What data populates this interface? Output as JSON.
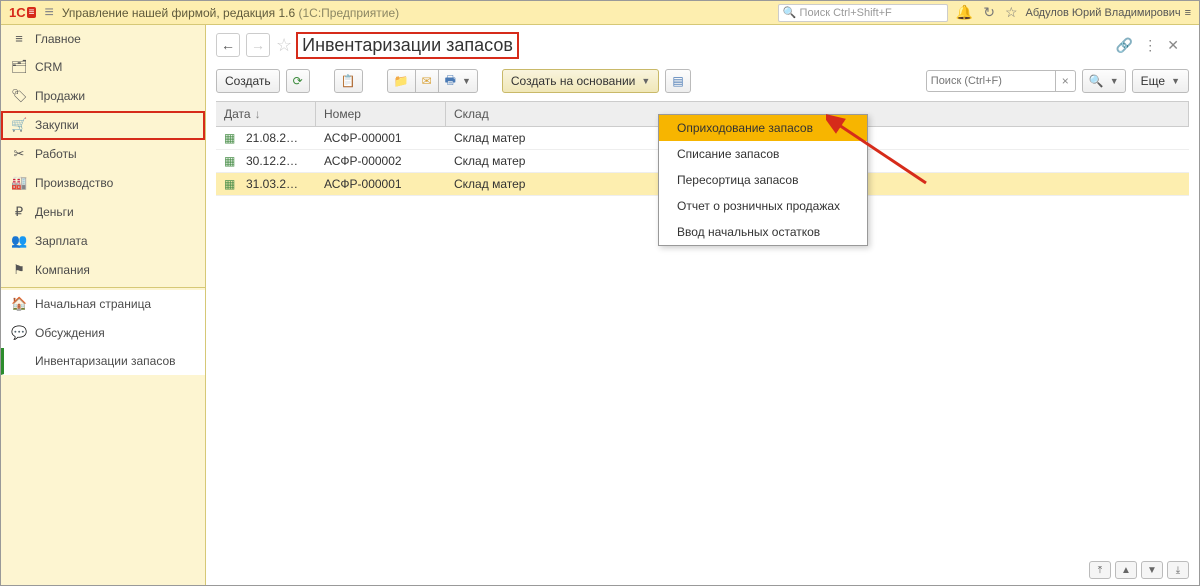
{
  "topbar": {
    "logo": "1C",
    "title": "Управление нашей фирмой, редакция 1.6",
    "sub": "(1С:Предприятие)",
    "search_placeholder": "Поиск Ctrl+Shift+F",
    "user": "Абдулов Юрий Владимирович"
  },
  "sidebar": {
    "items": [
      {
        "icon": "menu",
        "label": "Главное"
      },
      {
        "icon": "crm",
        "label": "CRM"
      },
      {
        "icon": "sales",
        "label": "Продажи"
      },
      {
        "icon": "cart",
        "label": "Закупки"
      },
      {
        "icon": "tools",
        "label": "Работы"
      },
      {
        "icon": "factory",
        "label": "Производство"
      },
      {
        "icon": "money",
        "label": "Деньги"
      },
      {
        "icon": "people",
        "label": "Зарплата"
      },
      {
        "icon": "flag",
        "label": "Компания"
      }
    ],
    "sub": [
      {
        "icon": "home",
        "label": "Начальная страница"
      },
      {
        "icon": "chat",
        "label": "Обсуждения"
      },
      {
        "icon": "",
        "label": "Инвентаризации запасов"
      }
    ]
  },
  "page": {
    "title": "Инвентаризации запасов",
    "create": "Создать",
    "create_based": "Создать на основании",
    "search_placeholder": "Поиск (Ctrl+F)",
    "more": "Еще"
  },
  "columns": {
    "date": "Дата",
    "num": "Номер",
    "wh": "Склад"
  },
  "rows": [
    {
      "date": "21.08.2…",
      "num": "АСФР-000001",
      "wh": "Склад матер"
    },
    {
      "date": "30.12.2…",
      "num": "АСФР-000002",
      "wh": "Склад матер"
    },
    {
      "date": "31.03.2…",
      "num": "АСФР-000001",
      "wh": "Склад матер"
    }
  ],
  "dropdown": [
    "Оприходование запасов",
    "Списание запасов",
    "Пересортица запасов",
    "Отчет о розничных продажах",
    "Ввод начальных остатков"
  ]
}
